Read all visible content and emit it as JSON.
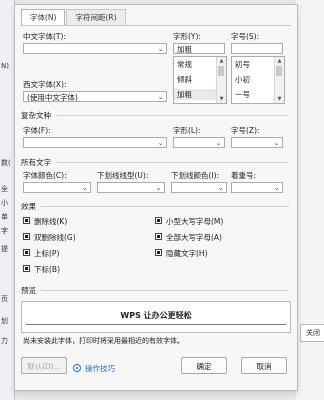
{
  "background": {
    "left_fragments": [
      "N)",
      "数(",
      "全",
      "小",
      "单",
      "字",
      "提",
      "页",
      "划",
      "力"
    ],
    "right_button_label": "关闭"
  },
  "tabs": [
    {
      "label": "字体(N)",
      "active": true
    },
    {
      "label": "字符间距(R)",
      "active": false
    }
  ],
  "chinese_font": {
    "label": "中文字体(T):",
    "value": ""
  },
  "style": {
    "label": "字形(Y):",
    "value": "加粗",
    "options": [
      "常规",
      "倾斜",
      "加粗"
    ],
    "selected": "加粗"
  },
  "size": {
    "label": "字号(S):",
    "value": "",
    "options": [
      "初号",
      "小初",
      "一号"
    ]
  },
  "western_font": {
    "label": "西文字体(X):",
    "value": "(使用中文字体)"
  },
  "complex_script": {
    "title": "复杂文种",
    "font_label": "字体(F):",
    "style_label": "字形(L):",
    "size_label": "字号(Z):"
  },
  "all_text": {
    "title": "所有文字",
    "color_label": "字体颜色(C):",
    "underline_type_label": "下划线线型(U):",
    "underline_color_label": "下划线颜色(I):",
    "emphasis_label": "着重号:"
  },
  "effects": {
    "title": "效果",
    "items": [
      {
        "label": "删除线(K)",
        "checked": true
      },
      {
        "label": "双删除线(G)",
        "checked": true
      },
      {
        "label": "上标(P)",
        "checked": true
      },
      {
        "label": "下标(B)",
        "checked": true
      },
      {
        "label": "小型大写字母(M)",
        "checked": true
      },
      {
        "label": "全部大写字母(A)",
        "checked": true
      },
      {
        "label": "隐藏文字(H)",
        "checked": true
      }
    ]
  },
  "preview": {
    "title": "预览",
    "sample": "WPS 让办公更轻松",
    "note": "尚未安装此字体，打印时将采用最相近的有效字体。"
  },
  "buttons": {
    "default": "默认(D)...",
    "tips": "操作技巧",
    "ok": "确定",
    "cancel": "取消"
  }
}
